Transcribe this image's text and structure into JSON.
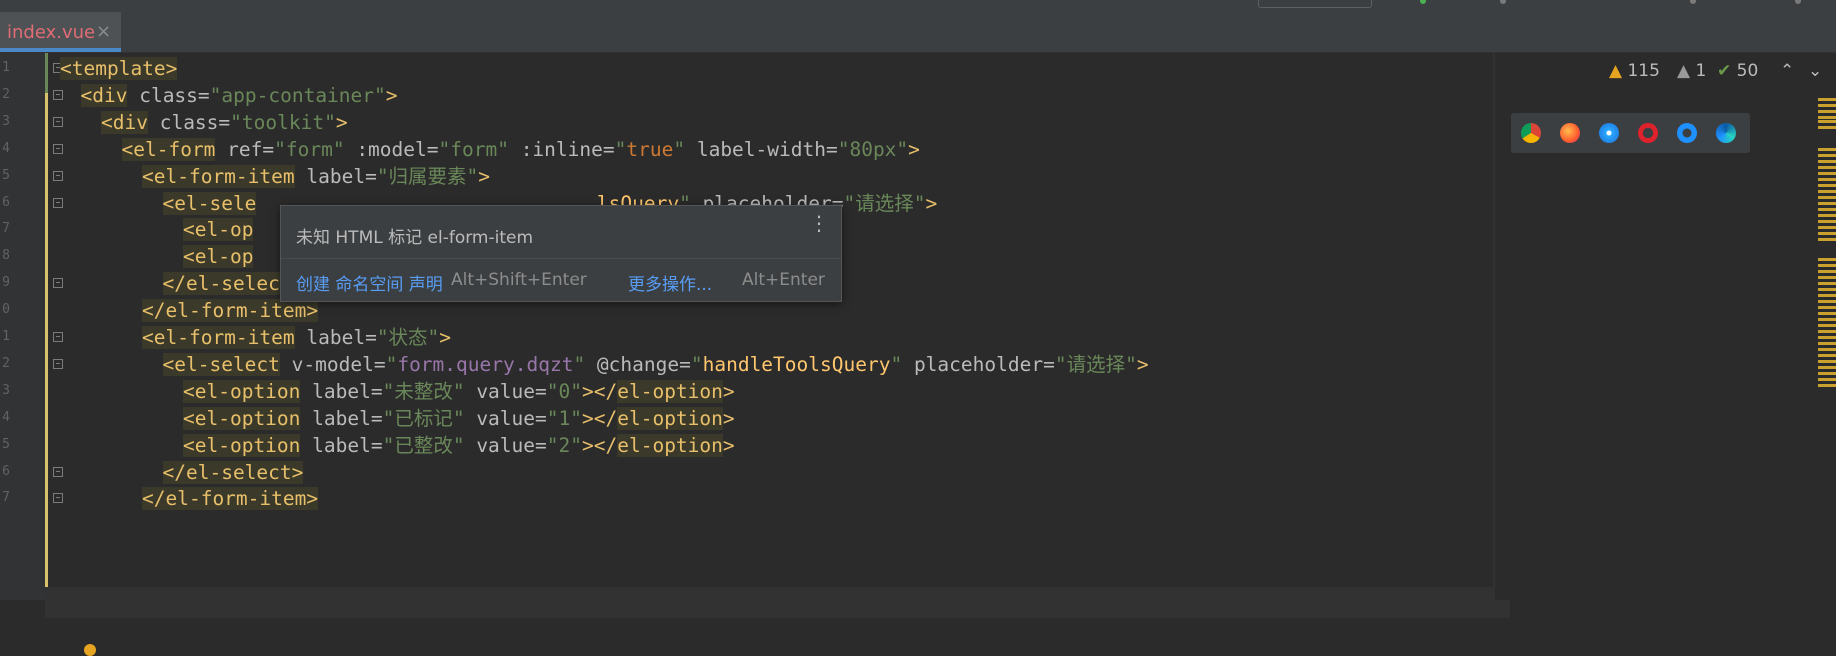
{
  "tab": {
    "label": "index.vue",
    "close": "×"
  },
  "colors": {
    "tab_text": "#e06c75",
    "tab_underline": "#4a88c7",
    "background": "#2b2b2b",
    "tag": "#e8bf6a",
    "string": "#6a8759",
    "keyword": "#cc7832",
    "field": "#9876aa",
    "function": "#ffc66d",
    "link": "#589df6"
  },
  "gutter": {
    "line_numbers": [
      "1",
      "2",
      "3",
      "4",
      "5",
      "6",
      "7",
      "8",
      "9",
      "0",
      "1",
      "2",
      "3",
      "4",
      "5",
      "6",
      "7"
    ]
  },
  "code": [
    {
      "tokens": [
        {
          "t": "tag",
          "v": "<template>"
        }
      ]
    },
    {
      "tokens": [
        {
          "t": "tag",
          "v": "<div"
        },
        {
          "t": "attr",
          "v": " class="
        },
        {
          "t": "val",
          "v": "\"app-container\""
        },
        {
          "t": "punct",
          "v": ">"
        }
      ]
    },
    {
      "tokens": [
        {
          "t": "tag",
          "v": "<div"
        },
        {
          "t": "attr",
          "v": " class="
        },
        {
          "t": "val",
          "v": "\"toolkit\""
        },
        {
          "t": "punct",
          "v": ">"
        }
      ]
    },
    {
      "tokens": [
        {
          "t": "tag",
          "v": "<el-form"
        },
        {
          "t": "attr",
          "v": " ref="
        },
        {
          "t": "val",
          "v": "\"form\""
        },
        {
          "t": "attr",
          "v": " :model="
        },
        {
          "t": "val",
          "v": "\"form\""
        },
        {
          "t": "attr",
          "v": " :inline="
        },
        {
          "t": "val",
          "v": "\""
        },
        {
          "t": "kw",
          "v": "true"
        },
        {
          "t": "val",
          "v": "\""
        },
        {
          "t": "attr",
          "v": " label-width="
        },
        {
          "t": "val",
          "v": "\"80px\""
        },
        {
          "t": "punct",
          "v": ">"
        }
      ]
    },
    {
      "tokens": [
        {
          "t": "tag",
          "v": "<el-form-item"
        },
        {
          "t": "attr",
          "v": " label="
        },
        {
          "t": "val",
          "v": "\"归属要素\""
        },
        {
          "t": "punct",
          "v": ">"
        }
      ]
    },
    {
      "tokens": [
        {
          "t": "tag",
          "v": "<el-sele"
        },
        {
          "t": "plain",
          "v": "                             "
        },
        {
          "t": "fn",
          "v": "lsQuery"
        },
        {
          "t": "val",
          "v": "\""
        },
        {
          "t": "attr",
          "v": " placeholder="
        },
        {
          "t": "val",
          "v": "\"请选择\""
        },
        {
          "t": "punct",
          "v": ">"
        }
      ]
    },
    {
      "tokens": [
        {
          "t": "tag",
          "v": "<el-op"
        }
      ]
    },
    {
      "tokens": [
        {
          "t": "tag",
          "v": "<el-op"
        }
      ]
    },
    {
      "tokens": [
        {
          "t": "tag",
          "v": "</el-select>"
        }
      ]
    },
    {
      "tokens": [
        {
          "t": "tag",
          "v": "</el-form-item>"
        }
      ]
    },
    {
      "tokens": [
        {
          "t": "tag",
          "v": "<el-form-item"
        },
        {
          "t": "attr",
          "v": " label="
        },
        {
          "t": "val",
          "v": "\"状态\""
        },
        {
          "t": "punct",
          "v": ">"
        }
      ]
    },
    {
      "tokens": [
        {
          "t": "tag",
          "v": "<el-select"
        },
        {
          "t": "attr",
          "v": " v-model="
        },
        {
          "t": "val",
          "v": "\""
        },
        {
          "t": "fld",
          "v": "form.query.dqzt"
        },
        {
          "t": "val",
          "v": "\""
        },
        {
          "t": "attr",
          "v": " @change="
        },
        {
          "t": "val",
          "v": "\""
        },
        {
          "t": "fn",
          "v": "handleToolsQuery"
        },
        {
          "t": "val",
          "v": "\""
        },
        {
          "t": "attr",
          "v": " placeholder="
        },
        {
          "t": "val",
          "v": "\"请选择\""
        },
        {
          "t": "punct",
          "v": ">"
        }
      ]
    },
    {
      "tokens": [
        {
          "t": "tag",
          "v": "<el-option"
        },
        {
          "t": "attr",
          "v": " label="
        },
        {
          "t": "val",
          "v": "\"未整改\""
        },
        {
          "t": "attr",
          "v": " value="
        },
        {
          "t": "val",
          "v": "\"0\""
        },
        {
          "t": "punct",
          "v": "></"
        },
        {
          "t": "tag",
          "v": "el-option"
        },
        {
          "t": "punct",
          "v": ">"
        }
      ]
    },
    {
      "tokens": [
        {
          "t": "tag",
          "v": "<el-option"
        },
        {
          "t": "attr",
          "v": " label="
        },
        {
          "t": "val",
          "v": "\"已标记\""
        },
        {
          "t": "attr",
          "v": " value="
        },
        {
          "t": "val",
          "v": "\"1\""
        },
        {
          "t": "punct",
          "v": "></"
        },
        {
          "t": "tag",
          "v": "el-option"
        },
        {
          "t": "punct",
          "v": ">"
        }
      ]
    },
    {
      "tokens": [
        {
          "t": "tag",
          "v": "<el-option"
        },
        {
          "t": "attr",
          "v": " label="
        },
        {
          "t": "val",
          "v": "\"已整改\""
        },
        {
          "t": "attr",
          "v": " value="
        },
        {
          "t": "val",
          "v": "\"2\""
        },
        {
          "t": "punct",
          "v": "></"
        },
        {
          "t": "tag",
          "v": "el-option"
        },
        {
          "t": "punct",
          "v": ">"
        }
      ]
    },
    {
      "tokens": [
        {
          "t": "tag",
          "v": "</el-select>"
        }
      ]
    },
    {
      "tokens": [
        {
          "t": "tag",
          "v": "</el-form-item>"
        }
      ]
    }
  ],
  "popup": {
    "title": "未知 HTML 标记 el-form-item",
    "more_icon": "kebab-menu-icon",
    "action1": "创建 命名空间 声明",
    "action1_key": "Alt+Shift+Enter",
    "action2": "更多操作...",
    "action2_key": "Alt+Enter"
  },
  "inspections": {
    "warnings": "115",
    "weak_warnings": "1",
    "ok": "50"
  },
  "browsers": [
    "chrome-icon",
    "firefox-icon",
    "safari-icon",
    "opera-icon",
    "ie-icon",
    "edge-icon"
  ]
}
